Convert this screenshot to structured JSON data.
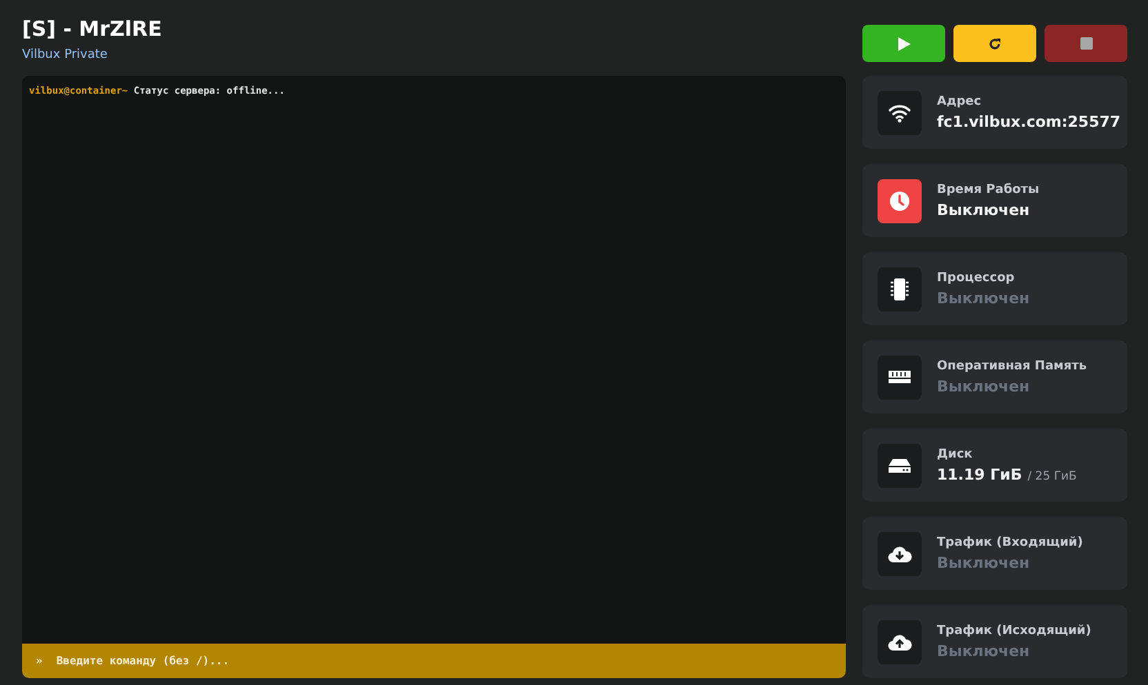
{
  "header": {
    "title": "[S] - MrZlRE",
    "subtitle": "Vilbux Private"
  },
  "console": {
    "lines": [
      {
        "prompt": "vilbux@container~",
        "text": "Статус сервера: offline..."
      }
    ],
    "input": {
      "icon": "»",
      "placeholder": "Введите команду (без /)..."
    }
  },
  "power_buttons": [
    {
      "kind": "start",
      "disabled": false
    },
    {
      "kind": "restart",
      "disabled": false
    },
    {
      "kind": "stop",
      "disabled": true
    }
  ],
  "stats": [
    {
      "kind": "wifi",
      "label": "Адрес",
      "value": "fc1.vilbux.com:25577",
      "dimmed": false,
      "alert": false
    },
    {
      "kind": "clock",
      "label": "Время Работы",
      "value": "Выключен",
      "dimmed": false,
      "alert": true
    },
    {
      "kind": "chip",
      "label": "Процессор",
      "value": "Выключен",
      "dimmed": true,
      "alert": false
    },
    {
      "kind": "memory",
      "label": "Оперативная Память",
      "value": "Выключен",
      "dimmed": true,
      "alert": false
    },
    {
      "kind": "disk",
      "label": "Диск",
      "value": "11.19 ГиБ",
      "sub": "/ 25 ГиБ",
      "dimmed": false,
      "alert": false
    },
    {
      "kind": "download",
      "label": "Трафик (Входящий)",
      "value": "Выключен",
      "dimmed": true,
      "alert": false
    },
    {
      "kind": "upload",
      "label": "Трафик (Исходящий)",
      "value": "Выключен",
      "dimmed": true,
      "alert": false
    }
  ]
}
